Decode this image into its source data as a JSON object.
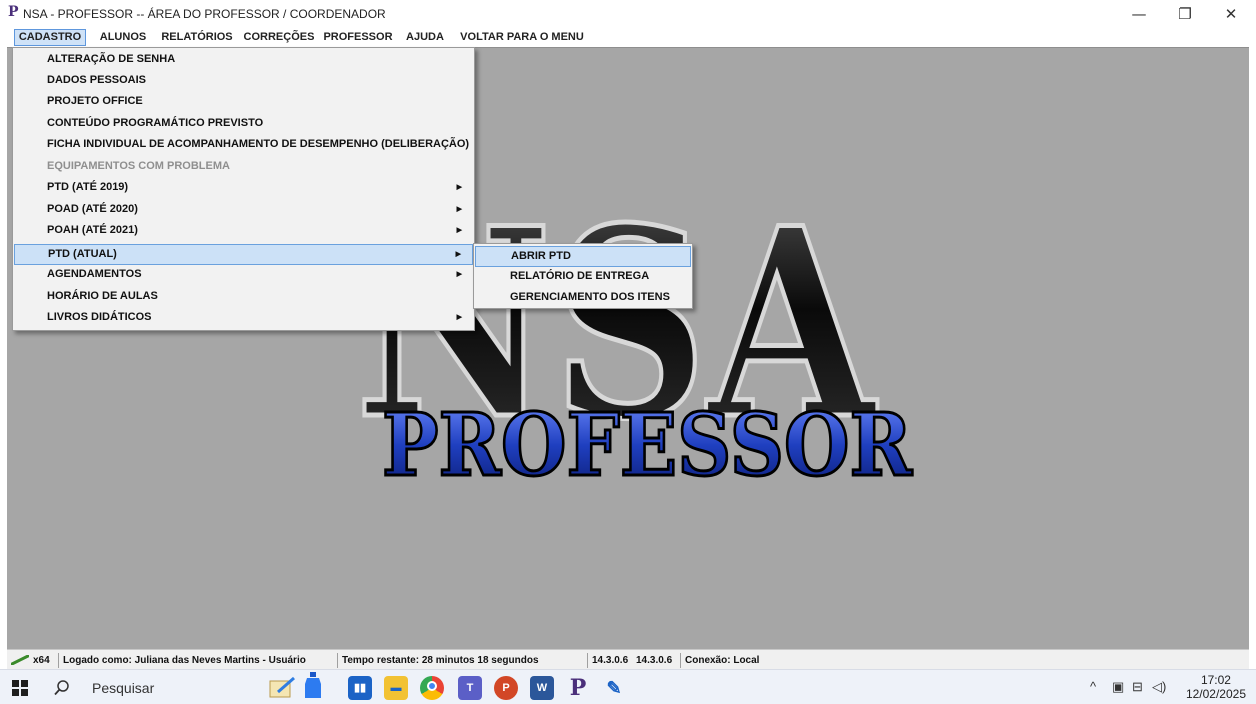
{
  "window": {
    "logo_letter": "P",
    "title": "NSA - PROFESSOR -- ÁREA DO PROFESSOR / COORDENADOR",
    "minimize": "—",
    "restore": "❐",
    "close": "✕"
  },
  "menubar": {
    "items": [
      "CADASTRO",
      "ALUNOS",
      "RELATÓRIOS",
      "CORREÇÕES",
      "PROFESSOR",
      "AJUDA",
      "VOLTAR PARA O MENU"
    ],
    "active": "CADASTRO"
  },
  "cadastro_menu": {
    "items": [
      {
        "label": "ALTERAÇÃO DE SENHA"
      },
      {
        "label": "DADOS PESSOAIS"
      },
      {
        "label": "PROJETO OFFICE"
      },
      {
        "label": "CONTEÚDO PROGRAMÁTICO PREVISTO"
      },
      {
        "label": "FICHA INDIVIDUAL DE ACOMPANHAMENTO DE DESEMPENHO (DELIBERAÇÃO)"
      },
      {
        "label": "EQUIPAMENTOS COM PROBLEMA",
        "disabled": true
      },
      {
        "label": "PTD (ATÉ 2019)",
        "submenu": true
      },
      {
        "label": "POAD (ATÉ 2020)",
        "submenu": true
      },
      {
        "label": "POAH (ATÉ 2021)",
        "submenu": true
      },
      {
        "label": "PTD (ATUAL)",
        "submenu": true,
        "highlighted": true
      },
      {
        "label": "AGENDAMENTOS",
        "submenu": true
      },
      {
        "label": "HORÁRIO DE AULAS"
      },
      {
        "label": "LIVROS DIDÁTICOS",
        "submenu": true
      }
    ]
  },
  "ptd_atual_submenu": {
    "items": [
      {
        "label": "ABRIR PTD",
        "highlighted": true
      },
      {
        "label": "RELATÓRIO DE ENTREGA"
      },
      {
        "label": "GERENCIAMENTO DOS ITENS"
      }
    ]
  },
  "logo": {
    "main": "NSA",
    "sub": "PROFESSOR"
  },
  "statusbar": {
    "arch": "x64",
    "user": "Logado como: Juliana das Neves Martins - Usuário",
    "time_remaining": "Tempo restante:  28  minutos  18  segundos",
    "version1": "14.3.0.6",
    "version2": "14.3.0.6",
    "connection": "Conexão: Local"
  },
  "taskbar": {
    "search_placeholder": "Pesquisar",
    "time": "17:02",
    "date": "12/02/2025"
  },
  "colors": {
    "workspace": "#a6a6a6",
    "menu_highlight": "#cce1f7",
    "logo_blue": "#1f3fbf"
  }
}
